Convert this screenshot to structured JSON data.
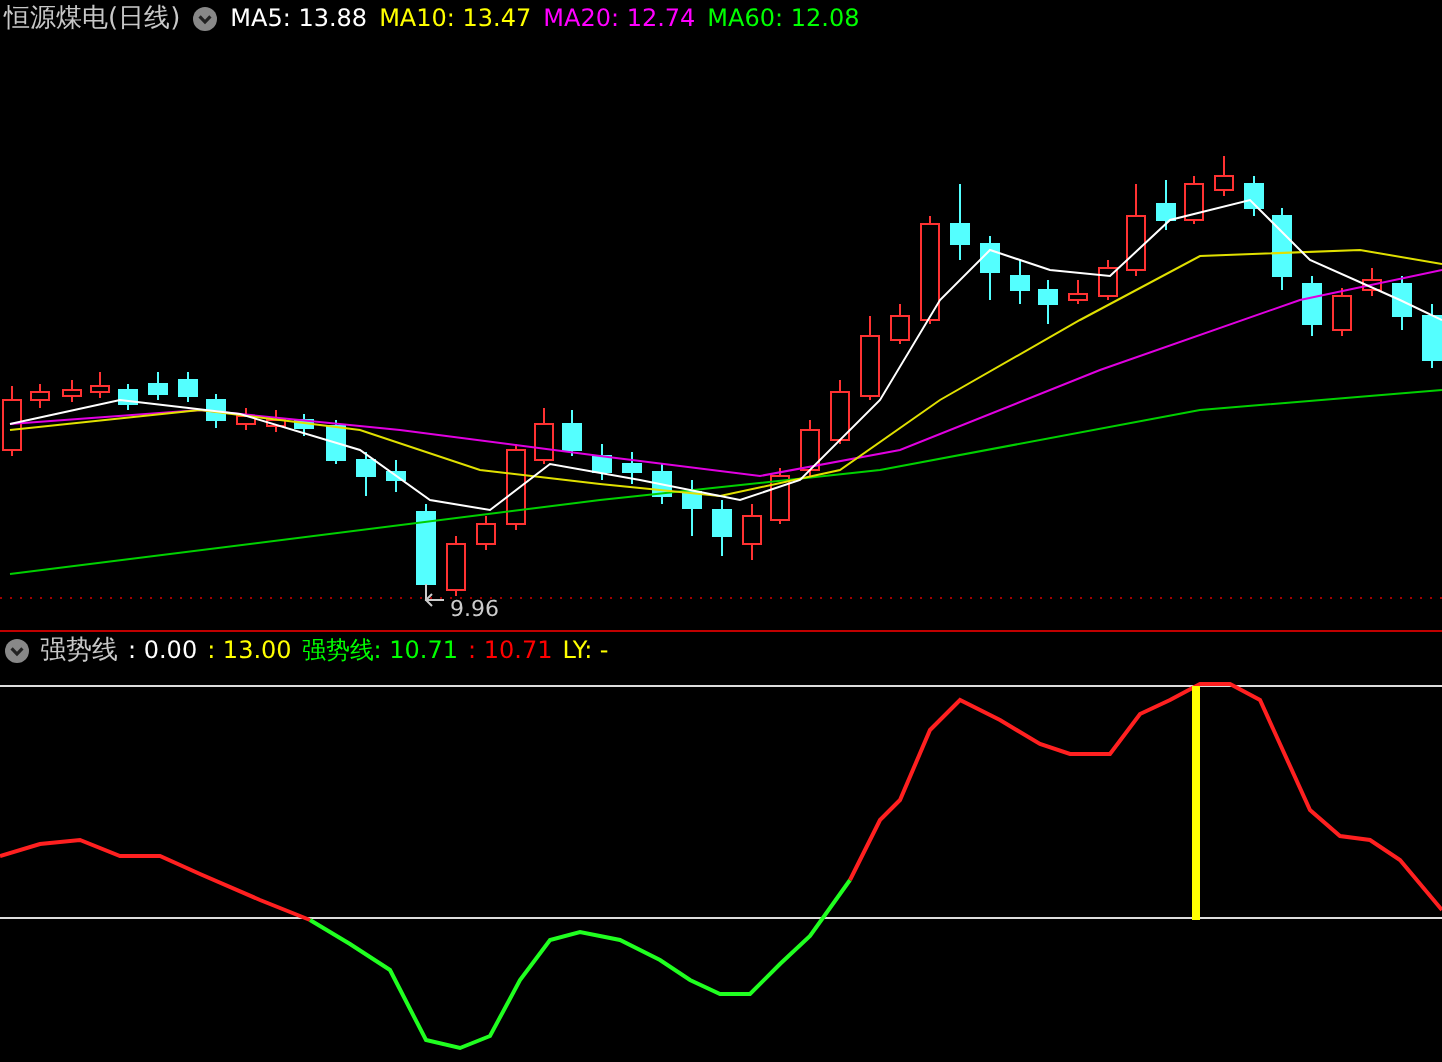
{
  "title": {
    "text": "恒源煤电(日线)"
  },
  "legend": [
    {
      "label": "MA5: 13.88",
      "color": "#ffffff"
    },
    {
      "label": "MA10: 13.47",
      "color": "#ffff00"
    },
    {
      "label": "MA20: 12.74",
      "color": "#ff00ff"
    },
    {
      "label": "MA60: 12.08",
      "color": "#00ff00"
    }
  ],
  "price_chart": {
    "low_marker": "9.96"
  },
  "indicator": {
    "name": "强势线",
    "legend": [
      {
        "label": ": 0.00",
        "color": "#ffffff"
      },
      {
        "label": ": 13.00",
        "color": "#ffff00"
      },
      {
        "label": "强势线: 10.71",
        "color": "#00ff00"
      },
      {
        "label": ": 10.71",
        "color": "#ff0000"
      },
      {
        "label": "LY: -",
        "color": "#ffff00"
      }
    ]
  }
}
